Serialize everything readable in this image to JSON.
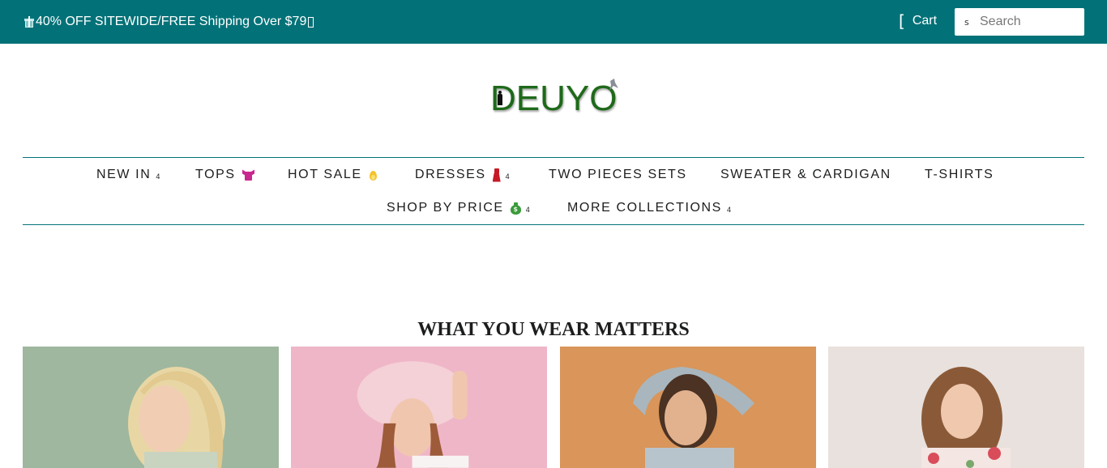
{
  "topbar": {
    "promo_text": "40% OFF SITEWIDE/FREE Shipping Over $79",
    "promo_icon": "gift-icon",
    "cart_label": "Cart",
    "cart_icon": "[",
    "search_icon": "s",
    "search_placeholder": "Search",
    "background_color": "#037278"
  },
  "logo": {
    "text": "DEUYO",
    "color": "#1e6a1a"
  },
  "nav": {
    "row1": [
      {
        "label": "NEW IN",
        "caret": "4"
      },
      {
        "label": "TOPS",
        "icon": "shirt-icon"
      },
      {
        "label": "HOT SALE",
        "icon": "fire-icon"
      },
      {
        "label": "DRESSES",
        "icon": "dress-icon",
        "caret": "4"
      },
      {
        "label": "TWO PIECES SETS"
      },
      {
        "label": "SWEATER & CARDIGAN"
      },
      {
        "label": "T-SHIRTS"
      }
    ],
    "row2": [
      {
        "label": "SHOP BY PRICE",
        "icon": "money-bag-icon",
        "caret": "4"
      },
      {
        "label": "MORE COLLECTIONS",
        "caret": "4"
      }
    ],
    "border_color": "#037278"
  },
  "section": {
    "title": "WHAT YOU WEAR MATTERS"
  },
  "tiles": [
    {
      "bg": "#9fb79e"
    },
    {
      "bg": "#efb6c8"
    },
    {
      "bg": "#d9955a"
    },
    {
      "bg": "#e9e1dd"
    }
  ]
}
